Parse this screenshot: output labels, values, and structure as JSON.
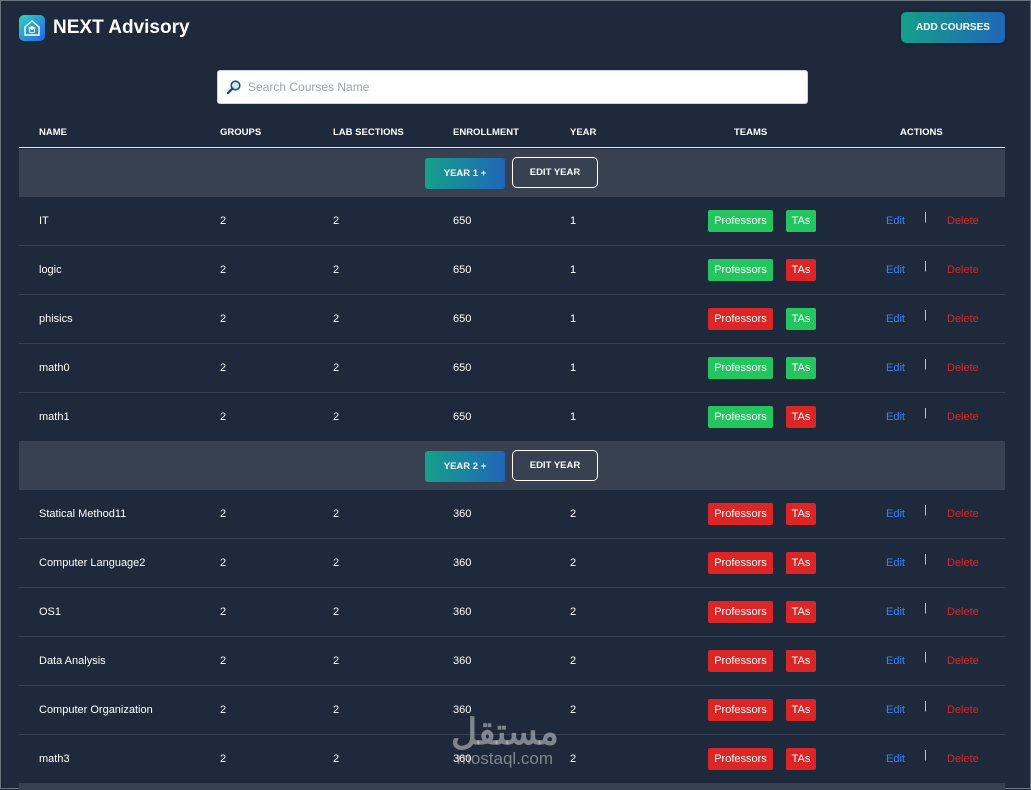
{
  "app": {
    "title": "NEXT Advisory",
    "add_courses_label": "ADD COURSES",
    "logo_icon": "graduation-home-icon"
  },
  "search": {
    "placeholder": "Search Courses Name",
    "value": ""
  },
  "columns": [
    "NAME",
    "GROUPS",
    "LAB SECTIONS",
    "ENROLLMENT",
    "YEAR",
    "TEAMS",
    "ACTIONS"
  ],
  "colors": {
    "background": "#1e293b",
    "section_row": "#374151",
    "green": "#22c55e",
    "red": "#dc2626",
    "edit_link": "#3b82f6",
    "accent_gradient": [
      "#14a08a",
      "#2066b8"
    ]
  },
  "year_groups": [
    {
      "label": "YEAR 1 +",
      "edit_label": "EDIT YEAR",
      "courses": [
        {
          "name": "IT",
          "groups": "2",
          "lab_sections": "2",
          "enrollment": "650",
          "year": "1",
          "professors": "Professors",
          "professors_status": "green",
          "tas": "TAs",
          "tas_status": "green",
          "edit": "Edit",
          "delete": "Delete"
        },
        {
          "name": "logic",
          "groups": "2",
          "lab_sections": "2",
          "enrollment": "650",
          "year": "1",
          "professors": "Professors",
          "professors_status": "green",
          "tas": "TAs",
          "tas_status": "red",
          "edit": "Edit",
          "delete": "Delete"
        },
        {
          "name": "phisics",
          "groups": "2",
          "lab_sections": "2",
          "enrollment": "650",
          "year": "1",
          "professors": "Professors",
          "professors_status": "red",
          "tas": "TAs",
          "tas_status": "green",
          "edit": "Edit",
          "delete": "Delete"
        },
        {
          "name": "math0",
          "groups": "2",
          "lab_sections": "2",
          "enrollment": "650",
          "year": "1",
          "professors": "Professors",
          "professors_status": "green",
          "tas": "TAs",
          "tas_status": "green",
          "edit": "Edit",
          "delete": "Delete"
        },
        {
          "name": "math1",
          "groups": "2",
          "lab_sections": "2",
          "enrollment": "650",
          "year": "1",
          "professors": "Professors",
          "professors_status": "green",
          "tas": "TAs",
          "tas_status": "red",
          "edit": "Edit",
          "delete": "Delete"
        }
      ]
    },
    {
      "label": "YEAR 2 +",
      "edit_label": "EDIT YEAR",
      "courses": [
        {
          "name": "Statical Method11",
          "groups": "2",
          "lab_sections": "2",
          "enrollment": "360",
          "year": "2",
          "professors": "Professors",
          "professors_status": "red",
          "tas": "TAs",
          "tas_status": "red",
          "edit": "Edit",
          "delete": "Delete"
        },
        {
          "name": "Computer Language2",
          "groups": "2",
          "lab_sections": "2",
          "enrollment": "360",
          "year": "2",
          "professors": "Professors",
          "professors_status": "red",
          "tas": "TAs",
          "tas_status": "red",
          "edit": "Edit",
          "delete": "Delete"
        },
        {
          "name": "OS1",
          "groups": "2",
          "lab_sections": "2",
          "enrollment": "360",
          "year": "2",
          "professors": "Professors",
          "professors_status": "red",
          "tas": "TAs",
          "tas_status": "red",
          "edit": "Edit",
          "delete": "Delete"
        },
        {
          "name": "Data Analysis",
          "groups": "2",
          "lab_sections": "2",
          "enrollment": "360",
          "year": "2",
          "professors": "Professors",
          "professors_status": "red",
          "tas": "TAs",
          "tas_status": "red",
          "edit": "Edit",
          "delete": "Delete"
        },
        {
          "name": "Computer Organization",
          "groups": "2",
          "lab_sections": "2",
          "enrollment": "360",
          "year": "2",
          "professors": "Professors",
          "professors_status": "red",
          "tas": "TAs",
          "tas_status": "red",
          "edit": "Edit",
          "delete": "Delete"
        },
        {
          "name": "math3",
          "groups": "2",
          "lab_sections": "2",
          "enrollment": "360",
          "year": "2",
          "professors": "Professors",
          "professors_status": "red",
          "tas": "TAs",
          "tas_status": "red",
          "edit": "Edit",
          "delete": "Delete"
        }
      ]
    }
  ],
  "watermark": {
    "arabic": "مستقل",
    "latin": "mostaql.com"
  }
}
